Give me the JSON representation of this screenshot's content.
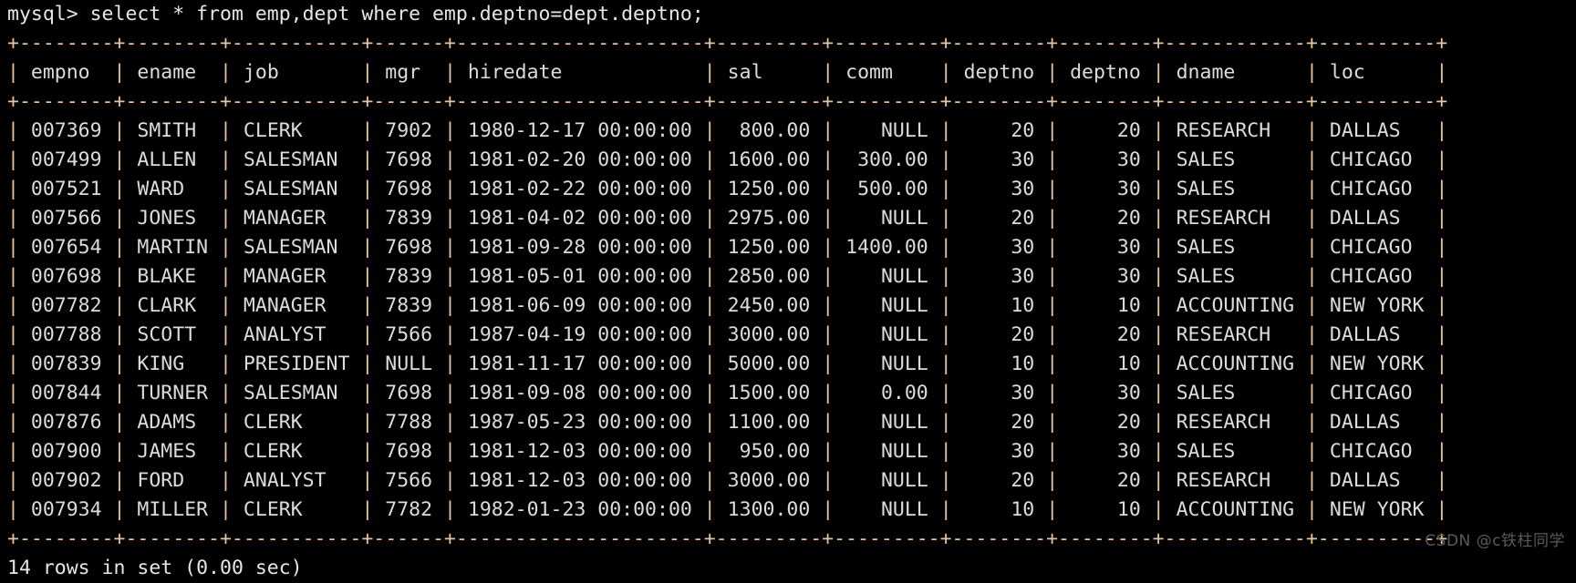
{
  "terminal": {
    "prompt": "mysql> ",
    "command": "select * from emp,dept where emp.deptno=dept.deptno;",
    "prompt_line": "mysql> select * from emp,dept where emp.deptno=dept.deptno;",
    "footer": "14 rows in set (0.00 sec)",
    "watermark": "CSDN @c铁柱同学",
    "colors": {
      "background": "#000000",
      "text": "#d8d8d8",
      "border": "#e8c49a"
    }
  },
  "table": {
    "columns": [
      {
        "name": "empno",
        "width": 6,
        "align": "right"
      },
      {
        "name": "ename",
        "width": 6,
        "align": "left"
      },
      {
        "name": "job",
        "width": 9,
        "align": "left"
      },
      {
        "name": "mgr",
        "width": 4,
        "align": "right"
      },
      {
        "name": "hiredate",
        "width": 19,
        "align": "left"
      },
      {
        "name": "sal",
        "width": 7,
        "align": "right"
      },
      {
        "name": "comm",
        "width": 7,
        "align": "right"
      },
      {
        "name": "deptno",
        "width": 6,
        "align": "right"
      },
      {
        "name": "deptno",
        "width": 6,
        "align": "right"
      },
      {
        "name": "dname",
        "width": 10,
        "align": "left"
      },
      {
        "name": "loc",
        "width": 8,
        "align": "left"
      }
    ],
    "rows": [
      [
        "007369",
        "SMITH",
        "CLERK",
        "7902",
        "1980-12-17 00:00:00",
        "800.00",
        "NULL",
        "20",
        "20",
        "RESEARCH",
        "DALLAS"
      ],
      [
        "007499",
        "ALLEN",
        "SALESMAN",
        "7698",
        "1981-02-20 00:00:00",
        "1600.00",
        "300.00",
        "30",
        "30",
        "SALES",
        "CHICAGO"
      ],
      [
        "007521",
        "WARD",
        "SALESMAN",
        "7698",
        "1981-02-22 00:00:00",
        "1250.00",
        "500.00",
        "30",
        "30",
        "SALES",
        "CHICAGO"
      ],
      [
        "007566",
        "JONES",
        "MANAGER",
        "7839",
        "1981-04-02 00:00:00",
        "2975.00",
        "NULL",
        "20",
        "20",
        "RESEARCH",
        "DALLAS"
      ],
      [
        "007654",
        "MARTIN",
        "SALESMAN",
        "7698",
        "1981-09-28 00:00:00",
        "1250.00",
        "1400.00",
        "30",
        "30",
        "SALES",
        "CHICAGO"
      ],
      [
        "007698",
        "BLAKE",
        "MANAGER",
        "7839",
        "1981-05-01 00:00:00",
        "2850.00",
        "NULL",
        "30",
        "30",
        "SALES",
        "CHICAGO"
      ],
      [
        "007782",
        "CLARK",
        "MANAGER",
        "7839",
        "1981-06-09 00:00:00",
        "2450.00",
        "NULL",
        "10",
        "10",
        "ACCOUNTING",
        "NEW YORK"
      ],
      [
        "007788",
        "SCOTT",
        "ANALYST",
        "7566",
        "1987-04-19 00:00:00",
        "3000.00",
        "NULL",
        "20",
        "20",
        "RESEARCH",
        "DALLAS"
      ],
      [
        "007839",
        "KING",
        "PRESIDENT",
        "NULL",
        "1981-11-17 00:00:00",
        "5000.00",
        "NULL",
        "10",
        "10",
        "ACCOUNTING",
        "NEW YORK"
      ],
      [
        "007844",
        "TURNER",
        "SALESMAN",
        "7698",
        "1981-09-08 00:00:00",
        "1500.00",
        "0.00",
        "30",
        "30",
        "SALES",
        "CHICAGO"
      ],
      [
        "007876",
        "ADAMS",
        "CLERK",
        "7788",
        "1987-05-23 00:00:00",
        "1100.00",
        "NULL",
        "20",
        "20",
        "RESEARCH",
        "DALLAS"
      ],
      [
        "007900",
        "JAMES",
        "CLERK",
        "7698",
        "1981-12-03 00:00:00",
        "950.00",
        "NULL",
        "30",
        "30",
        "SALES",
        "CHICAGO"
      ],
      [
        "007902",
        "FORD",
        "ANALYST",
        "7566",
        "1981-12-03 00:00:00",
        "3000.00",
        "NULL",
        "20",
        "20",
        "RESEARCH",
        "DALLAS"
      ],
      [
        "007934",
        "MILLER",
        "CLERK",
        "7782",
        "1982-01-23 00:00:00",
        "1300.00",
        "NULL",
        "10",
        "10",
        "ACCOUNTING",
        "NEW YORK"
      ]
    ],
    "row_count": 14
  }
}
